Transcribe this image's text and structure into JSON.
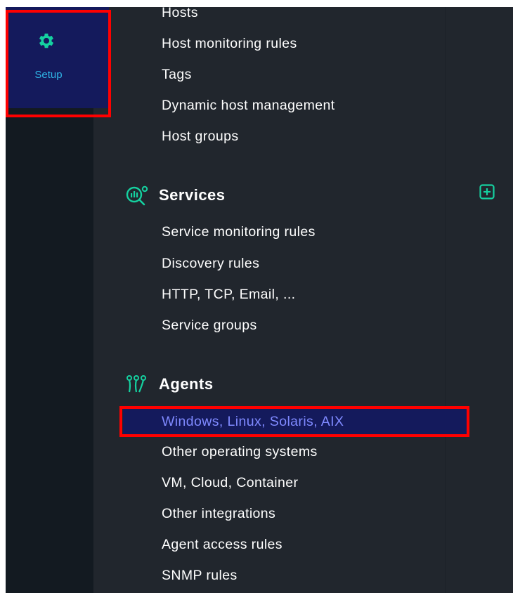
{
  "sidebar": {
    "setup_label": "Setup",
    "setup_icon": "gear-icon"
  },
  "hosts_section": {
    "items": [
      "Hosts",
      "Host monitoring rules",
      "Tags",
      "Dynamic host management",
      "Host groups"
    ]
  },
  "services_section": {
    "title": "Services",
    "icon": "services-icon",
    "add_icon": "plus-square-icon",
    "items": [
      "Service monitoring rules",
      "Discovery rules",
      "HTTP, TCP, Email, ...",
      "Service groups"
    ]
  },
  "agents_section": {
    "title": "Agents",
    "icon": "agents-icon",
    "items": [
      "Windows, Linux, Solaris, AIX",
      "Other operating systems",
      "VM, Cloud, Container",
      "Other integrations",
      "Agent access rules",
      "SNMP rules"
    ]
  },
  "colors": {
    "panel_bg": "#21262d",
    "sidebar_bg": "#131a21",
    "selected_bg": "#141a5c",
    "accent_green": "#15d1a0",
    "accent_blue": "#2fb5e6",
    "highlight_text": "#7f89ff",
    "annotation_red": "#ff0000"
  }
}
